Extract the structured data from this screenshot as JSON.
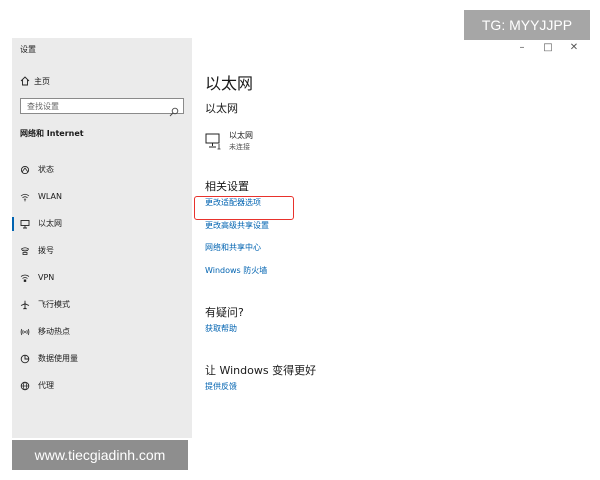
{
  "window": {
    "app_title": "设置",
    "controls": {
      "minimize": "–",
      "maximize": "□",
      "close": "✕"
    }
  },
  "sidebar": {
    "home_label": "主页",
    "search_placeholder": "查找设置",
    "section_title": "网络和 Internet",
    "items": [
      {
        "label": "状态",
        "icon": "status-icon",
        "active": false
      },
      {
        "label": "WLAN",
        "icon": "wifi-icon",
        "active": false
      },
      {
        "label": "以太网",
        "icon": "ethernet-icon",
        "active": true
      },
      {
        "label": "拨号",
        "icon": "dialup-icon",
        "active": false
      },
      {
        "label": "VPN",
        "icon": "vpn-icon",
        "active": false
      },
      {
        "label": "飞行模式",
        "icon": "airplane-icon",
        "active": false
      },
      {
        "label": "移动热点",
        "icon": "hotspot-icon",
        "active": false
      },
      {
        "label": "数据使用量",
        "icon": "data-usage-icon",
        "active": false
      },
      {
        "label": "代理",
        "icon": "proxy-icon",
        "active": false
      }
    ]
  },
  "main": {
    "page_title": "以太网",
    "sub_title": "以太网",
    "adapter": {
      "name": "以太网",
      "status": "未连接"
    },
    "related": {
      "heading": "相关设置",
      "links": [
        "更改适配器选项",
        "更改高级共享设置",
        "网络和共享中心",
        "Windows 防火墙"
      ]
    },
    "help": {
      "heading": "有疑问?",
      "link": "获取帮助"
    },
    "feedback": {
      "heading": "让 Windows 变得更好",
      "link": "提供反馈"
    }
  },
  "overlays": {
    "tg_badge": "TG: MYYJJPP",
    "watermark": "www.tiecgiadinh.com",
    "highlight_color": "#e8322c"
  },
  "colors": {
    "accent": "#0063b1",
    "sidebar_bg": "#ebebeb"
  }
}
